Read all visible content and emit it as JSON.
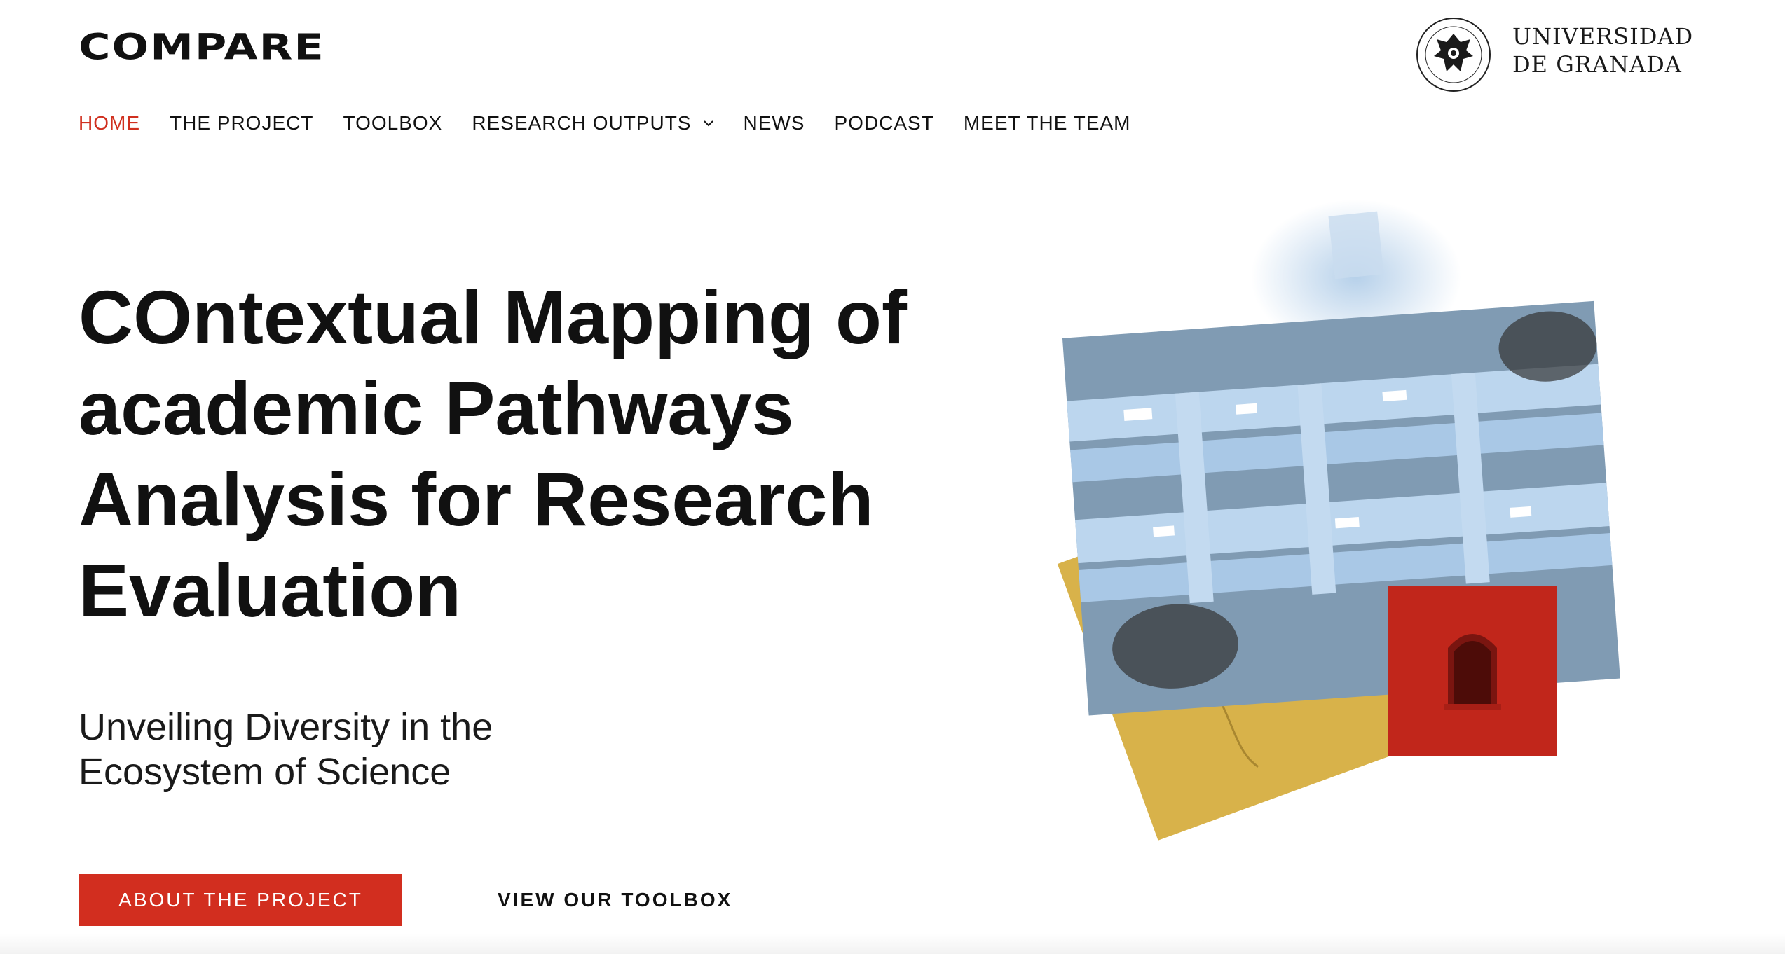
{
  "brand": {
    "logo_text": "COMPARE"
  },
  "partner": {
    "name_line1": "UNIVERSIDAD",
    "name_line2": "DE GRANADA",
    "seal_icon": "university-seal-icon"
  },
  "nav": {
    "items": [
      {
        "label": "HOME",
        "active": true
      },
      {
        "label": "THE PROJECT",
        "active": false
      },
      {
        "label": "TOOLBOX",
        "active": false
      },
      {
        "label": "RESEARCH OUTPUTS",
        "active": false,
        "has_dropdown": true
      },
      {
        "label": "NEWS",
        "active": false
      },
      {
        "label": "PODCAST",
        "active": false
      },
      {
        "label": "MEET THE TEAM",
        "active": false
      }
    ]
  },
  "hero": {
    "title_lines": [
      [
        {
          "bold": "CO",
          "rest": "ntextual "
        },
        {
          "bold": "M",
          "rest": "apping of"
        }
      ],
      [
        {
          "bold": "",
          "rest": "academic "
        },
        {
          "bold": "P",
          "rest": "athways"
        }
      ],
      [
        {
          "bold": "A",
          "rest": "nalysis for "
        },
        {
          "bold": "R",
          "rest": "esearch"
        }
      ],
      [
        {
          "bold": "E",
          "rest": "valuation"
        }
      ]
    ],
    "subtitle_lines": [
      "Unveiling Diversity in the",
      "Ecosystem of Science"
    ],
    "primary_button": "ABOUT THE PROJECT",
    "secondary_link": "VIEW OUR TOOLBOX"
  },
  "colors": {
    "accent": "#d0301f",
    "button": "#d22e1f",
    "photo_blue": "#9cc0e0",
    "map_yellow": "#d8b24a",
    "text": "#111111"
  }
}
